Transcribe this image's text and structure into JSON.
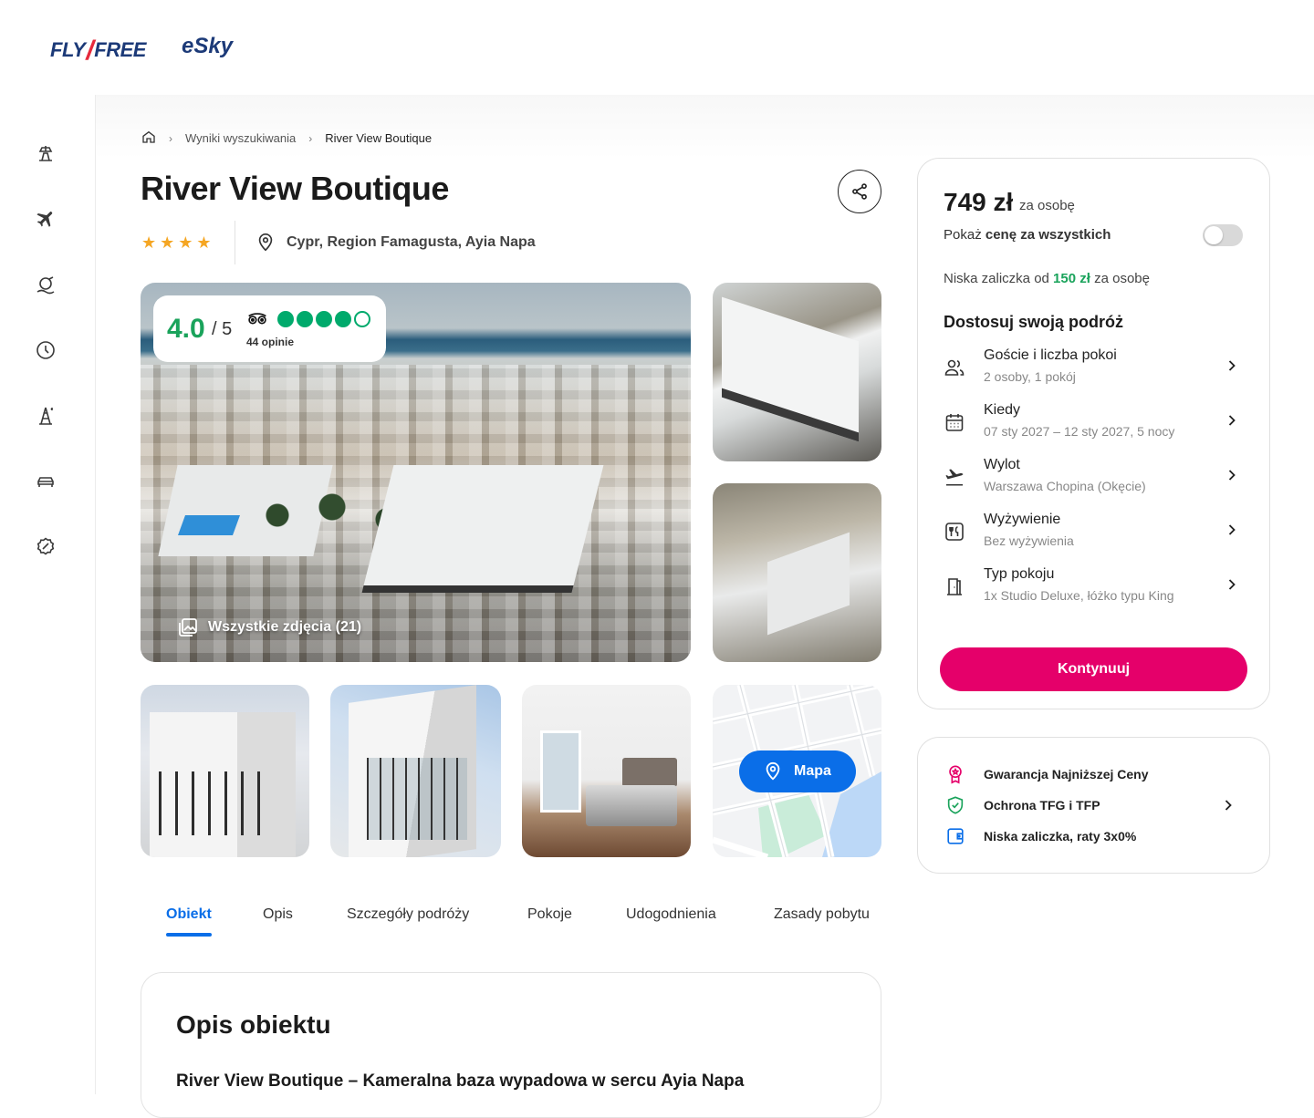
{
  "brand": {
    "flyfree_left": "FLY",
    "flyfree_right": "FREE",
    "esky": "eSky"
  },
  "sidebar": {
    "items": [
      {
        "icon": "beach-holiday-icon"
      },
      {
        "icon": "plane-icon"
      },
      {
        "icon": "island-icon"
      },
      {
        "icon": "clock-icon"
      },
      {
        "icon": "landmark-icon"
      },
      {
        "icon": "car-icon"
      },
      {
        "icon": "discount-icon"
      }
    ]
  },
  "breadcrumb": {
    "home_icon": "home-icon",
    "results": "Wyniki wyszukiwania",
    "current": "River View Boutique"
  },
  "hotel": {
    "name": "River View Boutique",
    "stars": 4,
    "location": "Cypr, Region Famagusta, Ayia Napa"
  },
  "rating": {
    "score": "4.0",
    "max": "/ 5",
    "bubbles_filled": 4,
    "bubbles_total": 5,
    "reviews": "44 opinie"
  },
  "gallery": {
    "all_photos": "Wszystkie zdjęcia (21)",
    "map_label": "Mapa"
  },
  "tabs": [
    {
      "label": "Obiekt",
      "active": true
    },
    {
      "label": "Opis"
    },
    {
      "label": "Szczegóły podróży"
    },
    {
      "label": "Pokoje"
    },
    {
      "label": "Udogodnienia"
    },
    {
      "label": "Zasady pobytu"
    }
  ],
  "description": {
    "title": "Opis obiektu",
    "subtitle": "River View Boutique – Kameralna baza wypadowa w sercu Ayia Napa"
  },
  "booking": {
    "price": "749 zł",
    "price_unit": "za osobę",
    "toggle_prefix": "Pokaż ",
    "toggle_bold": "cenę za wszystkich",
    "toggle_on": false,
    "deposit_prefix": "Niska zaliczka od ",
    "deposit_amount": "150 zł",
    "deposit_suffix": " za osobę",
    "customize_title": "Dostosuj swoją podróż",
    "options": [
      {
        "icon": "guests-icon",
        "label": "Goście i liczba pokoi",
        "value": "2 osoby, 1 pokój"
      },
      {
        "icon": "calendar-icon",
        "label": "Kiedy",
        "value": "07 sty 2027 – 12 sty 2027, 5 nocy"
      },
      {
        "icon": "departure-icon",
        "label": "Wylot",
        "value": "Warszawa Chopina (Okęcie)"
      },
      {
        "icon": "meal-icon",
        "label": "Wyżywienie",
        "value": "Bez wyżywienia"
      },
      {
        "icon": "door-icon",
        "label": "Typ pokoju",
        "value": "1x Studio Deluxe, łóżko typu King"
      }
    ],
    "continue": "Kontynuuj"
  },
  "guarantees": [
    {
      "icon": "award-icon",
      "label": "Gwarancja Najniższej Ceny",
      "color": "#e5006a"
    },
    {
      "icon": "shield-check-icon",
      "label": "Ochrona TFG i TFP",
      "color": "#1aa35b"
    },
    {
      "icon": "wallet-icon",
      "label": "Niska zaliczka, raty 3x0%",
      "color": "#0a6ee8"
    }
  ],
  "colors": {
    "accent_blue": "#0a6ee8",
    "accent_pink": "#e5006a",
    "accent_green": "#1aa35b",
    "star": "#f5a623"
  }
}
